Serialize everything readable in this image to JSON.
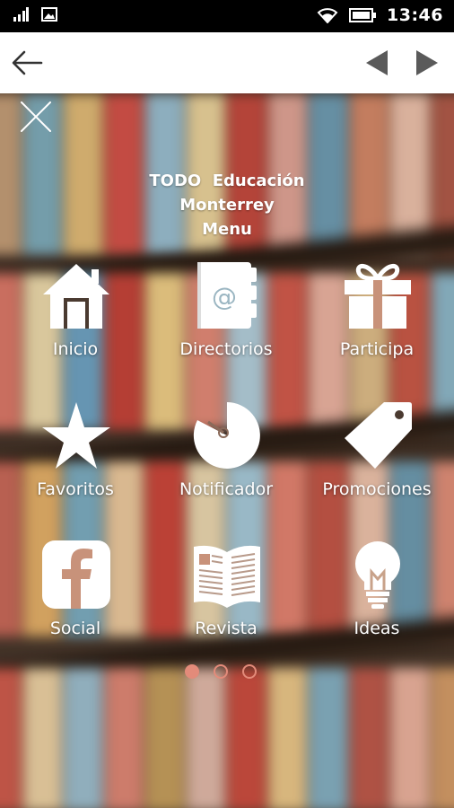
{
  "status_bar": {
    "time": "13:46",
    "icons": [
      "signal-icon",
      "image-icon",
      "wifi-icon",
      "battery-icon"
    ]
  },
  "toolbar": {
    "back_icon": "arrow-left-icon",
    "prev_icon": "triangle-left-icon",
    "next_icon": "triangle-right-icon"
  },
  "menu": {
    "close_icon": "close-x-icon",
    "title_line1": "TODO  Educación",
    "title_line2": "Monterrey",
    "title_line3": "Menu",
    "items": [
      {
        "label": "Inicio",
        "icon": "home-icon"
      },
      {
        "label": "Directorios",
        "icon": "address-book-icon"
      },
      {
        "label": "Participa",
        "icon": "gift-icon"
      },
      {
        "label": "Favoritos",
        "icon": "star-icon"
      },
      {
        "label": "Notificador",
        "icon": "timer-icon"
      },
      {
        "label": "Promociones",
        "icon": "tag-icon"
      },
      {
        "label": "Social",
        "icon": "facebook-icon"
      },
      {
        "label": "Revista",
        "icon": "magazine-icon"
      },
      {
        "label": "Ideas",
        "icon": "lightbulb-icon"
      }
    ],
    "page_indicator": {
      "pages": 3,
      "current": 1
    }
  },
  "colors": {
    "accent": "#e38b7a",
    "status_bar": "#000000",
    "toolbar": "#ffffff",
    "toolbar_icon": "#555555",
    "menu_text": "#ffffff"
  }
}
